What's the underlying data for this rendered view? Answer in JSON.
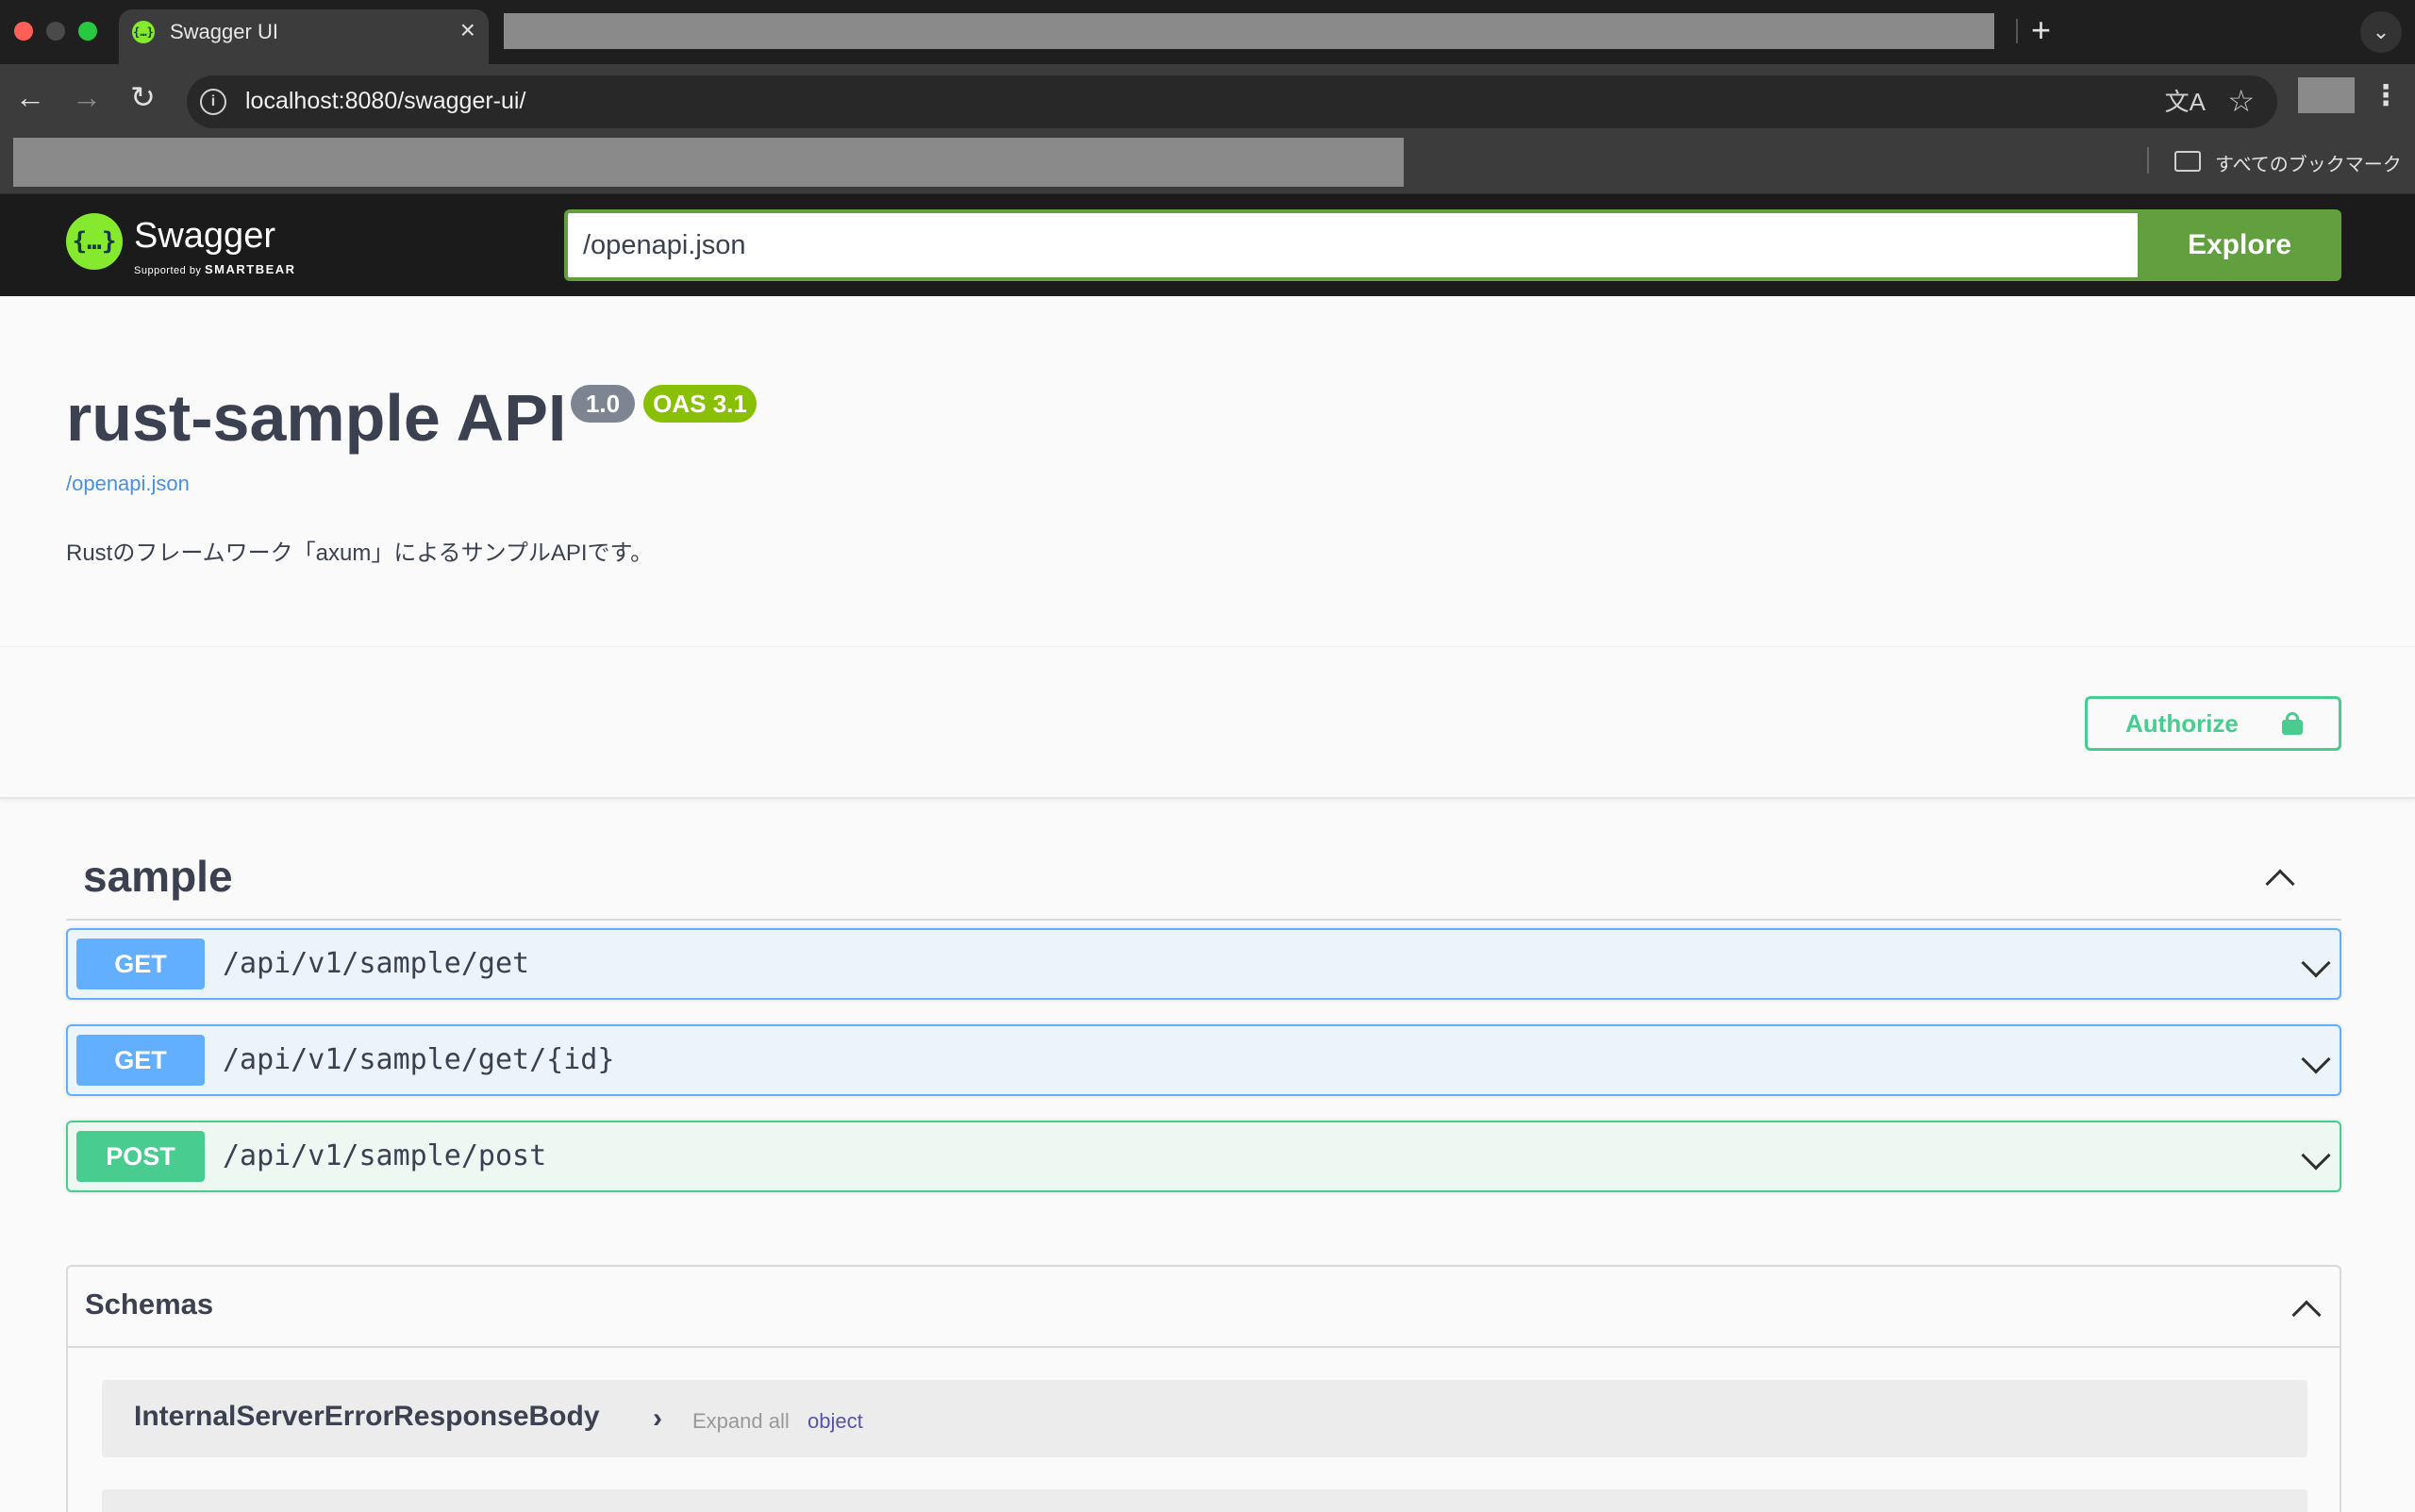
{
  "browser": {
    "tab_title": "Swagger UI",
    "tab_close": "×",
    "new_tab": "+",
    "tab_list": "⌄",
    "back": "←",
    "forward": "→",
    "reload": "↻",
    "info": "i",
    "url": "localhost:8080/swagger-ui/",
    "translate": "文A",
    "bookmark_star": "☆",
    "menu": "⋮",
    "bookmarks_all": "すべてのブックマーク"
  },
  "topbar": {
    "logo_text": "Swagger",
    "logo_icon": "{…}",
    "logo_sub_prefix": "Supported by",
    "logo_sub_brand": "SMARTBEAR",
    "url_value": "/openapi.json",
    "explore_label": "Explore",
    "brand_color": "#85ea2d",
    "accent_color": "#62a03f"
  },
  "info": {
    "title": "rust-sample API",
    "version": "1.0",
    "oas": "OAS 3.1",
    "link": "/openapi.json",
    "description": "Rustのフレームワーク「axum」によるサンプルAPIです。"
  },
  "auth": {
    "authorize_label": "Authorize",
    "icon": "lock-icon"
  },
  "tag": {
    "name": "sample"
  },
  "operations": [
    {
      "method": "GET",
      "path": "/api/v1/sample/get"
    },
    {
      "method": "GET",
      "path": "/api/v1/sample/get/{id}"
    },
    {
      "method": "POST",
      "path": "/api/v1/sample/post"
    }
  ],
  "colors": {
    "get": "#61affe",
    "post": "#49cc90"
  },
  "schemas": {
    "title": "Schemas",
    "models": [
      {
        "name": "InternalServerErrorResponseBody",
        "arrow": "›",
        "expand": "Expand all",
        "type": "object"
      }
    ]
  }
}
